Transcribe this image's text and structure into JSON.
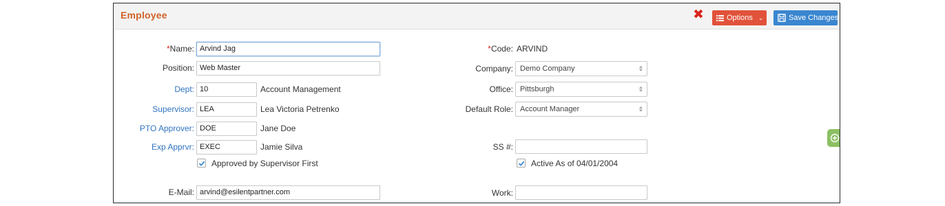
{
  "header": {
    "title": "Employee",
    "options_label": "Options",
    "save_label": "Save Changes"
  },
  "colors": {
    "title": "#d0622a",
    "options_button": "#e1523a",
    "save_button": "#3a86d0",
    "close_icon": "#d9261c",
    "side_tab": "#8cc063",
    "link_label": "#2f74c0"
  },
  "icons": {
    "close": "close-icon",
    "options": "list-icon",
    "save": "save-icon",
    "side_tab": "plus-circle-icon"
  },
  "form": {
    "name": {
      "required_mark": "*",
      "label": "Name:",
      "value": "Arvind Jag"
    },
    "position": {
      "label": "Position:",
      "value": "Web Master"
    },
    "dept": {
      "label": "Dept:",
      "value": "10",
      "description": "Account Management"
    },
    "supervisor": {
      "label": "Supervisor:",
      "value": "LEA",
      "description": "Lea Victoria Petrenko"
    },
    "pto_approver": {
      "label": "PTO Approver:",
      "value": "DOE",
      "description": "Jane Doe"
    },
    "exp_approver": {
      "label": "Exp Apprvr:",
      "value": "EXEC",
      "description": "Jamie Silva"
    },
    "approved_by_supervisor": {
      "label": "Approved by Supervisor First",
      "checked": true
    },
    "email": {
      "label": "E-Mail:",
      "value": "arvind@esilentpartner.com"
    },
    "code": {
      "required_mark": "*",
      "label": "Code:",
      "value": "ARVIND"
    },
    "company": {
      "label": "Company:",
      "value": "Demo Company"
    },
    "office": {
      "label": "Office:",
      "value": "Pittsburgh"
    },
    "default_role": {
      "label": "Default Role:",
      "value": "Account Manager"
    },
    "ssn": {
      "label": "SS #:",
      "value": ""
    },
    "active": {
      "label": "Active As of 04/01/2004",
      "checked": true
    },
    "work": {
      "label": "Work:",
      "value": ""
    }
  }
}
